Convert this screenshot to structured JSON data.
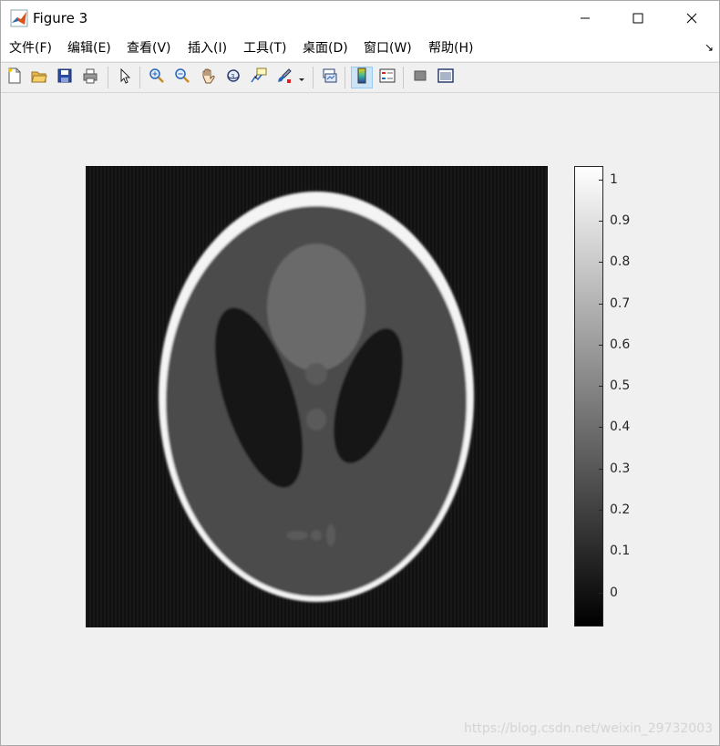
{
  "window": {
    "title": "Figure 3",
    "icon": "matlab-logo-icon",
    "controls": [
      "minimize-icon",
      "maximize-icon",
      "close-icon"
    ]
  },
  "menu": {
    "items": [
      "文件(F)",
      "编辑(E)",
      "查看(V)",
      "插入(I)",
      "工具(T)",
      "桌面(D)",
      "窗口(W)",
      "帮助(H)"
    ],
    "corner_glyph": "↘"
  },
  "toolbar": {
    "icons": [
      "new-figure-icon",
      "open-file-icon",
      "save-icon",
      "print-icon",
      "select-arrow-icon",
      "zoom-in-icon",
      "zoom-out-icon",
      "pan-hand-icon",
      "rotate-3d-icon",
      "data-cursor-icon",
      "brush-icon",
      "link-plot-icon",
      "colorbar-icon",
      "legend-icon",
      "hide-plot-tools-icon",
      "show-plot-tools-icon"
    ],
    "active": "colorbar-icon"
  },
  "figure": {
    "image": "shepp-logan-phantom-reconstruction",
    "colormap": "gray",
    "colorbar": {
      "ticks": [
        0,
        0.1,
        0.2,
        0.3,
        0.4,
        0.5,
        0.6,
        0.7,
        0.8,
        0.9,
        1
      ],
      "tick_labels": [
        "0",
        "0.1",
        "0.2",
        "0.3",
        "0.4",
        "0.5",
        "0.6",
        "0.7",
        "0.8",
        "0.9",
        "1"
      ],
      "range": [
        -0.08,
        1.03
      ]
    }
  },
  "watermark": "https://blog.csdn.net/weixin_29732003"
}
